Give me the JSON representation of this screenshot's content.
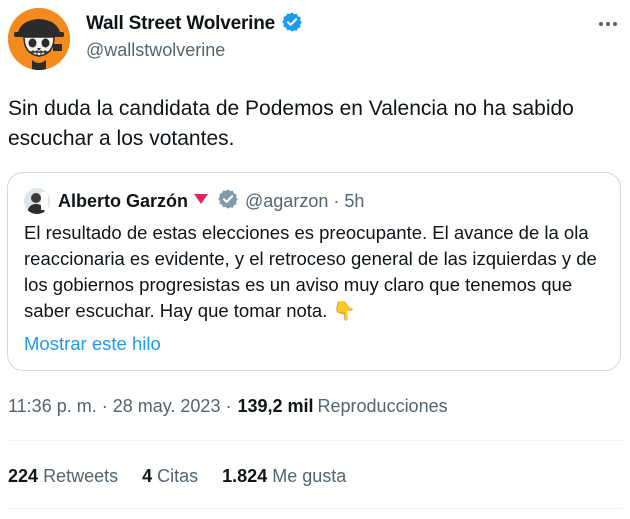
{
  "author": {
    "name": "Wall Street Wolverine",
    "handle": "@wallstwolverine",
    "verified": true
  },
  "tweet": {
    "text": "Sin duda la candidata de Podemos en Valencia no ha sabido escuchar a los votantes."
  },
  "quoted": {
    "name": "Alberto Garzón",
    "handle": "@agarzon",
    "separator": "·",
    "time": "5h",
    "text": "El resultado de estas elecciones es preocupante. El avance de la ola reaccionaria es evidente, y el retroceso general de las izquierdas y de los gobiernos progresistas es un aviso muy claro que tenemos que saber escuchar. Hay que tomar nota. 👇",
    "show_thread": "Mostrar este hilo"
  },
  "meta": {
    "timestamp": "11:36 p. m. · 28 may. 2023 ·",
    "views_count": "139,2 mil",
    "views_label": "Reproducciones"
  },
  "stats": {
    "retweets_count": "224",
    "retweets_label": "Retweets",
    "quotes_count": "4",
    "quotes_label": "Citas",
    "likes_count": "1.824",
    "likes_label": "Me gusta"
  },
  "colors": {
    "verified": "#1d9bf0",
    "affiliate_badge": "#829aab",
    "link": "#1d9bf0",
    "muted": "#536471",
    "flag": "#e0245e",
    "avatar_bg": "#f28a1e"
  }
}
